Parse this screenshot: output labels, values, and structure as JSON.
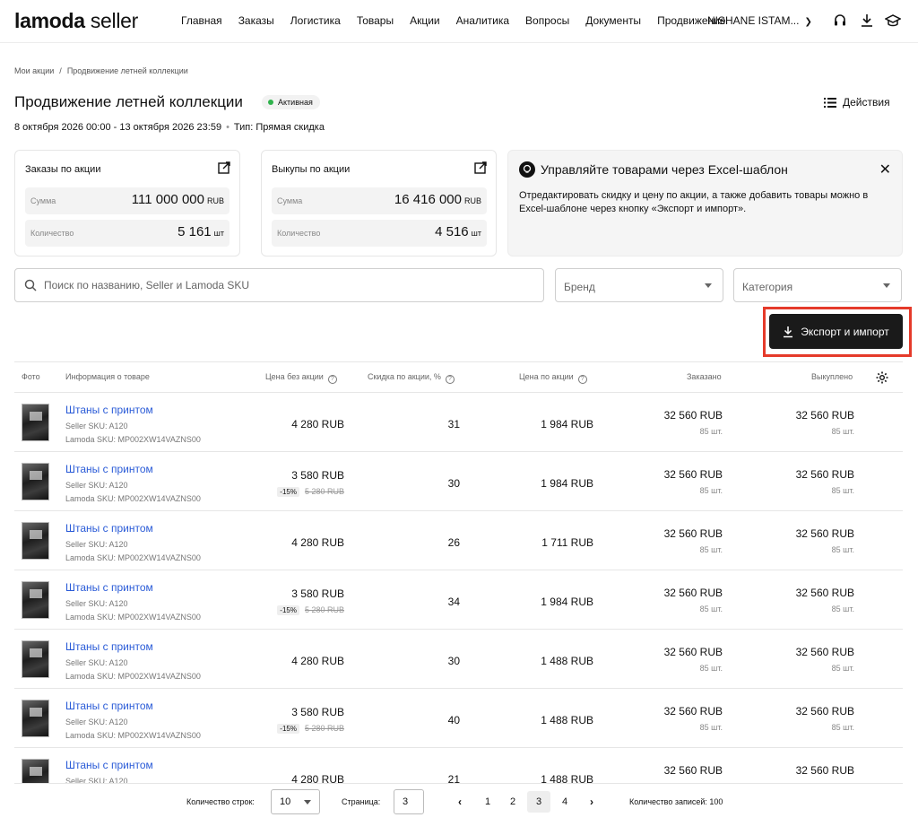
{
  "header": {
    "logo_brand": "lamoda",
    "logo_sub": "seller",
    "nav": [
      "Главная",
      "Заказы",
      "Логистика",
      "Товары",
      "Акции",
      "Аналитика",
      "Вопросы",
      "Документы",
      "Продвижение"
    ],
    "user": "NISHANE ISTAM..."
  },
  "breadcrumb": {
    "parent": "Мои акции",
    "separator": "/",
    "current": "Продвижение летней коллекции"
  },
  "promo": {
    "title": "Продвижение летней коллекции",
    "status": "Активная",
    "status_color": "#2fb24c",
    "period": "8 октября 2026 00:00 - 13 октября 2026 23:59",
    "type": "Тип: Прямая скидка",
    "actions_label": "Действия"
  },
  "cards": {
    "orders": {
      "title": "Заказы по акции",
      "sum_label": "Сумма",
      "sum_value": "111 000 000",
      "sum_unit": "RUB",
      "qty_label": "Количество",
      "qty_value": "5 161",
      "qty_unit": "шт"
    },
    "buyouts": {
      "title": "Выкупы по акции",
      "sum_label": "Сумма",
      "sum_value": "16 416 000",
      "sum_unit": "RUB",
      "qty_label": "Количество",
      "qty_value": "4 516",
      "qty_unit": "шт"
    },
    "info": {
      "title": "Управляйте товарами через Excel-шаблон",
      "text": "Отредактировать скидку и цену по акции, а также добавить товары можно в Excel-шаблоне через кнопку «Экспорт и импорт»."
    }
  },
  "filters": {
    "search_placeholder": "Поиск по названию, Seller и Lamoda SKU",
    "brand": "Бренд",
    "category": "Категория"
  },
  "export_button": "Экспорт и импорт",
  "highlight_color": "#e53a2a",
  "table": {
    "columns": {
      "photo": "Фото",
      "info": "Информация о товаре",
      "price_base": "Цена без акции",
      "discount": "Скидка по акции, %",
      "price_promo": "Цена по акции",
      "ordered": "Заказано",
      "bought": "Выкуплено"
    },
    "rows": [
      {
        "name": "Штаны с принтом",
        "seller_sku": "Seller SKU: A120",
        "lamoda_sku": "Lamoda SKU: MP002XW14VAZNS00",
        "price": "4 280 RUB",
        "old_pct": "",
        "old_price": "",
        "discount": "31",
        "promo_price": "1 984 RUB",
        "ordered": "32 560 RUB",
        "ordered_qty": "85 шт.",
        "bought": "32 560 RUB",
        "bought_qty": "85 шт."
      },
      {
        "name": "Штаны с принтом",
        "seller_sku": "Seller SKU: A120",
        "lamoda_sku": "Lamoda SKU: MP002XW14VAZNS00",
        "price": "3 580 RUB",
        "old_pct": "-15%",
        "old_price": "5 280 RUB",
        "discount": "30",
        "promo_price": "1 984 RUB",
        "ordered": "32 560 RUB",
        "ordered_qty": "85 шт.",
        "bought": "32 560 RUB",
        "bought_qty": "85 шт."
      },
      {
        "name": "Штаны с принтом",
        "seller_sku": "Seller SKU: A120",
        "lamoda_sku": "Lamoda SKU: MP002XW14VAZNS00",
        "price": "4 280 RUB",
        "old_pct": "",
        "old_price": "",
        "discount": "26",
        "promo_price": "1 711 RUB",
        "ordered": "32 560 RUB",
        "ordered_qty": "85 шт.",
        "bought": "32 560 RUB",
        "bought_qty": "85 шт."
      },
      {
        "name": "Штаны с принтом",
        "seller_sku": "Seller SKU: A120",
        "lamoda_sku": "Lamoda SKU: MP002XW14VAZNS00",
        "price": "3 580 RUB",
        "old_pct": "-15%",
        "old_price": "5 280 RUB",
        "discount": "34",
        "promo_price": "1 984 RUB",
        "ordered": "32 560 RUB",
        "ordered_qty": "85 шт.",
        "bought": "32 560 RUB",
        "bought_qty": "85 шт."
      },
      {
        "name": "Штаны с принтом",
        "seller_sku": "Seller SKU: A120",
        "lamoda_sku": "Lamoda SKU: MP002XW14VAZNS00",
        "price": "4 280 RUB",
        "old_pct": "",
        "old_price": "",
        "discount": "30",
        "promo_price": "1 488 RUB",
        "ordered": "32 560 RUB",
        "ordered_qty": "85 шт.",
        "bought": "32 560 RUB",
        "bought_qty": "85 шт."
      },
      {
        "name": "Штаны с принтом",
        "seller_sku": "Seller SKU: A120",
        "lamoda_sku": "Lamoda SKU: MP002XW14VAZNS00",
        "price": "3 580 RUB",
        "old_pct": "-15%",
        "old_price": "5 280 RUB",
        "discount": "40",
        "promo_price": "1 488 RUB",
        "ordered": "32 560 RUB",
        "ordered_qty": "85 шт.",
        "bought": "32 560 RUB",
        "bought_qty": "85 шт."
      },
      {
        "name": "Штаны с принтом",
        "seller_sku": "Seller SKU: A120",
        "lamoda_sku": "",
        "price": "4 280 RUB",
        "old_pct": "",
        "old_price": "",
        "discount": "21",
        "promo_price": "1 488 RUB",
        "ordered": "32 560 RUB",
        "ordered_qty": "",
        "bought": "32 560 RUB",
        "bought_qty": ""
      }
    ]
  },
  "pagination": {
    "rows_label": "Количество строк:",
    "rows_value": "10",
    "page_label": "Страница:",
    "page_value": "3",
    "pages": [
      "1",
      "2",
      "3",
      "4"
    ],
    "current_page": "3",
    "total": "Количество записей: 100"
  }
}
